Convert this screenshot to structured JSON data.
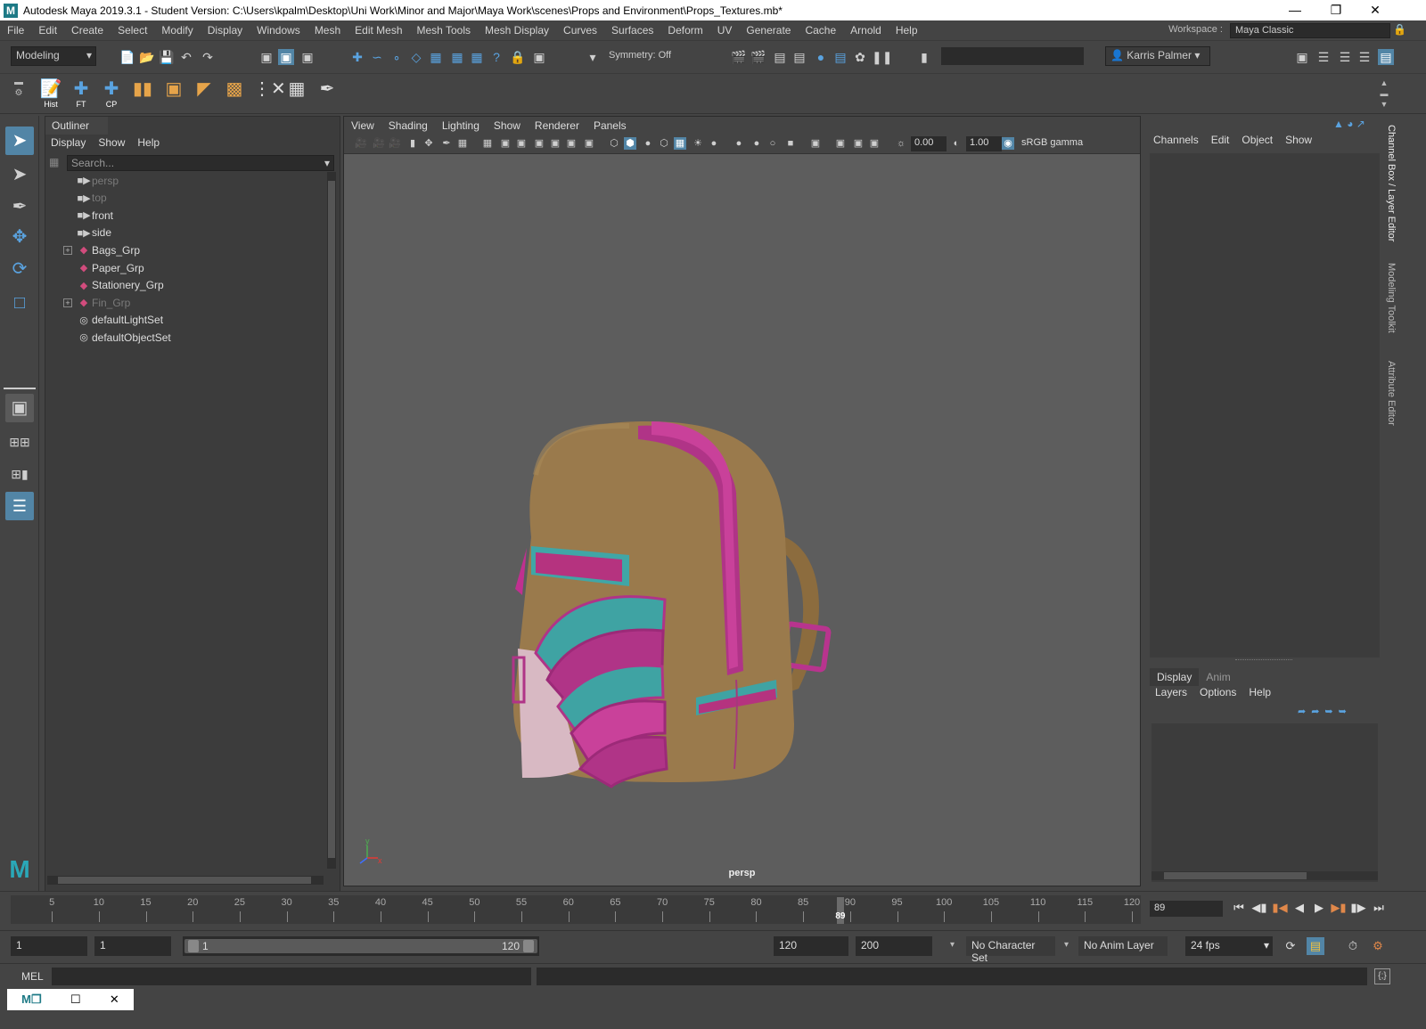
{
  "window": {
    "title": "Autodesk Maya 2019.3.1 - Student Version: C:\\Users\\kpalm\\Desktop\\Uni Work\\Minor and Major\\Maya Work\\scenes\\Props and Environment\\Props_Textures.mb*",
    "minimize": "—",
    "restore": "❐",
    "close": "✕"
  },
  "menubar": [
    "File",
    "Edit",
    "Create",
    "Select",
    "Modify",
    "Display",
    "Windows",
    "Mesh",
    "Edit Mesh",
    "Mesh Tools",
    "Mesh Display",
    "Curves",
    "Surfaces",
    "Deform",
    "UV",
    "Generate",
    "Cache",
    "Arnold",
    "Help"
  ],
  "workspace": {
    "label": "Workspace :",
    "value": "Maya Classic"
  },
  "statusline": {
    "menuset": "Modeling",
    "symmetry": "Symmetry: Off",
    "user": "Karris Palmer"
  },
  "shelf": {
    "buttons": [
      {
        "label": "Hist"
      },
      {
        "label": "FT"
      },
      {
        "label": "CP"
      }
    ]
  },
  "outliner": {
    "tab": "Outliner",
    "menu": [
      "Display",
      "Show",
      "Help"
    ],
    "search_placeholder": "Search...",
    "items": [
      {
        "label": "persp",
        "icon": "camera-icon",
        "dim": true,
        "expandable": false
      },
      {
        "label": "top",
        "icon": "camera-icon",
        "dim": true,
        "expandable": false
      },
      {
        "label": "front",
        "icon": "camera-icon",
        "dim": false,
        "expandable": false
      },
      {
        "label": "side",
        "icon": "camera-icon",
        "dim": false,
        "expandable": false
      },
      {
        "label": "Bags_Grp",
        "icon": "group-icon",
        "dim": false,
        "expandable": true
      },
      {
        "label": "Paper_Grp",
        "icon": "group-icon",
        "dim": false,
        "expandable": false
      },
      {
        "label": "Stationery_Grp",
        "icon": "group-icon",
        "dim": false,
        "expandable": false
      },
      {
        "label": "Fin_Grp",
        "icon": "group-icon",
        "dim": true,
        "expandable": true
      },
      {
        "label": "defaultLightSet",
        "icon": "set-icon",
        "dim": false,
        "expandable": false
      },
      {
        "label": "defaultObjectSet",
        "icon": "set-icon",
        "dim": false,
        "expandable": false
      }
    ]
  },
  "viewport": {
    "menu": [
      "View",
      "Shading",
      "Lighting",
      "Show",
      "Renderer",
      "Panels"
    ],
    "exposure": "0.00",
    "gamma": "1.00",
    "colorspace": "sRGB gamma",
    "camera": "persp",
    "axis": {
      "x": "x",
      "y": "y"
    }
  },
  "channelbox": {
    "menu": [
      "Channels",
      "Edit",
      "Object",
      "Show"
    ],
    "layer_tabs": [
      "Display",
      "Anim"
    ],
    "layer_menu": [
      "Layers",
      "Options",
      "Help"
    ]
  },
  "side_tabs": [
    "Channel Box / Layer Editor",
    "Modeling Toolkit",
    "Attribute Editor"
  ],
  "timeslider": {
    "start": 1,
    "end": 120,
    "current": 89,
    "labels": [
      "5",
      "10",
      "15",
      "20",
      "25",
      "30",
      "35",
      "40",
      "45",
      "50",
      "55",
      "60",
      "65",
      "70",
      "75",
      "80",
      "85",
      "90",
      "95",
      "100",
      "105",
      "110",
      "115",
      "120"
    ],
    "current_label": "89",
    "frame_field": "89"
  },
  "range": {
    "start_field": "1",
    "playback_start": "1",
    "slider_start": "1",
    "slider_end": "120",
    "playback_end": "120",
    "end_field": "200",
    "character_set": "No Character Set",
    "anim_layer": "No Anim Layer",
    "fps": "24 fps"
  },
  "cmdline": {
    "label": "MEL"
  },
  "colors": {
    "accent": "#5285a6",
    "bag_tan": "#9c7c4d",
    "magenta": "#c0308e",
    "teal": "#40a6a6"
  }
}
